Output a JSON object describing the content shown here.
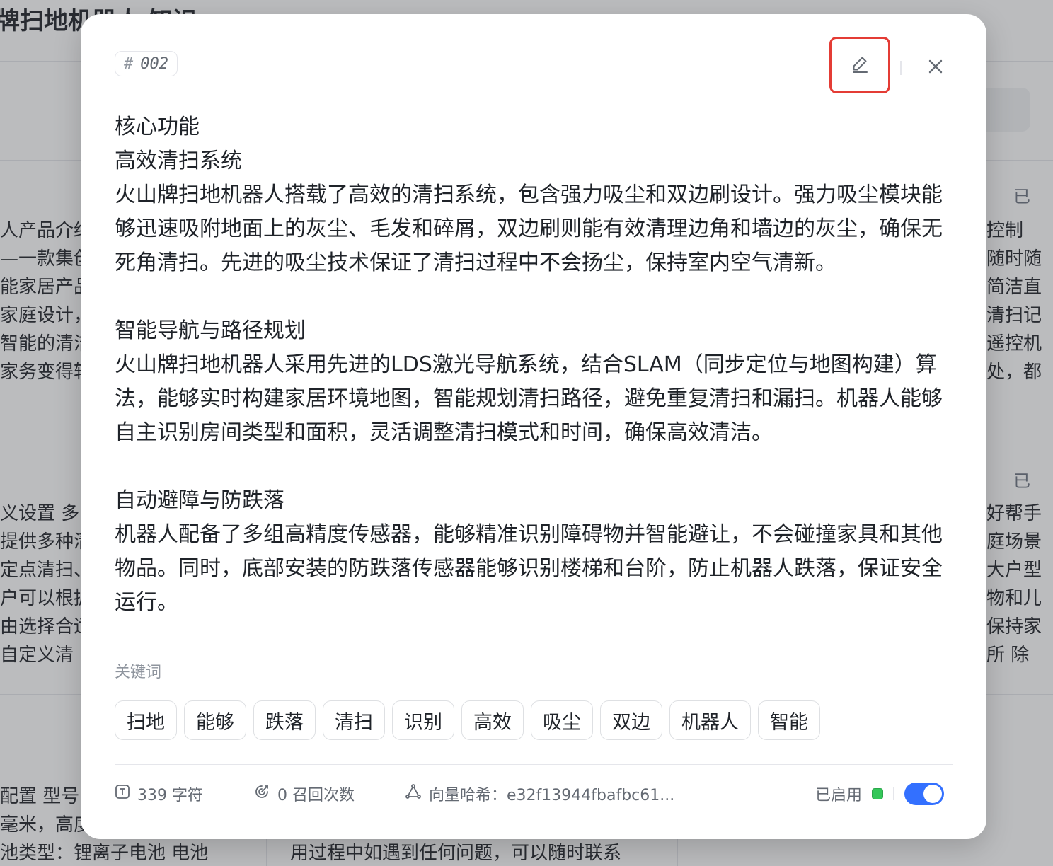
{
  "background": {
    "title": "牌扫地机器人 知识",
    "left_card_1_lines": [
      "人产品介绍",
      "—一款集创",
      "能家居产品",
      "家庭设计，",
      "智能的清洁",
      "家务变得轻"
    ],
    "left_card_2_lines": [
      "义设置 多",
      "提供多种清",
      "定点清扫、",
      "户可以根据",
      "由选择合适",
      " 自定义清"
    ],
    "left_card_3_lines": [
      "配置 型号",
      "毫米，高度",
      "池类型：锂离子电池 电池"
    ],
    "right_card_1_status": "已",
    "right_card_1_lines": [
      "控制",
      "随时随",
      "简洁直",
      "清扫记",
      "遥控机",
      "处，都"
    ],
    "right_card_2_status": "已",
    "right_card_2_lines": [
      "好帮手",
      "庭场景",
      "大户型",
      "物和儿",
      "保持家",
      "所 除"
    ],
    "bottom_middle_line": "用过程中如遇到任何问题，可以随时联系"
  },
  "modal": {
    "chunk_id_symbol": "#",
    "chunk_id": "002",
    "edit_icon": "pencil-icon",
    "close_icon": "close-icon",
    "content": "核心功能\n高效清扫系统\n火山牌扫地机器人搭载了高效的清扫系统，包含强力吸尘和双边刷设计。强力吸尘模块能够迅速吸附地面上的灰尘、毛发和碎屑，双边刷则能有效清理边角和墙边的灰尘，确保无死角清扫。先进的吸尘技术保证了清扫过程中不会扬尘，保持室内空气清新。\n\n智能导航与路径规划\n火山牌扫地机器人采用先进的LDS激光导航系统，结合SLAM（同步定位与地图构建）算法，能够实时构建家居环境地图，智能规划清扫路径，避免重复清扫和漏扫。机器人能够自主识别房间类型和面积，灵活调整清扫模式和时间，确保高效清洁。\n\n自动避障与防跌落\n机器人配备了多组高精度传感器，能够精准识别障碍物并智能避让，不会碰撞家具和其他物品。同时，底部安装的防跌落传感器能够识别楼梯和台阶，防止机器人跌落，保证安全运行。",
    "keywords_label": "关键词",
    "keywords": [
      "扫地",
      "能够",
      "跌落",
      "清扫",
      "识别",
      "高效",
      "吸尘",
      "双边",
      "机器人",
      "智能"
    ],
    "footer": {
      "char_count": "339 字符",
      "recall_count": "0 召回次数",
      "vector_hash": "向量哈希：e32f13944fbafbc61...",
      "status_label": "已启用",
      "enabled": true,
      "accent_color": "#3370ff",
      "status_dot_color": "#34c759"
    }
  }
}
